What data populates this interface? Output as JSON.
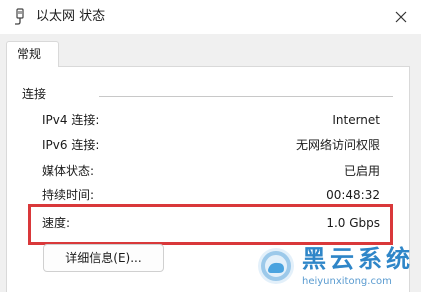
{
  "window": {
    "title": "以太网 状态",
    "title_icon": "ethernet-adapter-icon",
    "close_icon": "close-icon"
  },
  "tabs": [
    {
      "label": "常规",
      "selected": true
    }
  ],
  "connection": {
    "group_label": "连接",
    "rows": [
      {
        "label": "IPv4 连接:",
        "value": "Internet"
      },
      {
        "label": "IPv6 连接:",
        "value": "无网络访问权限"
      },
      {
        "label": "媒体状态:",
        "value": "已启用"
      },
      {
        "label": "持续时间:",
        "value": "00:48:32"
      },
      {
        "label": "速度:",
        "value": "1.0 Gbps"
      }
    ],
    "highlighted_row": "速度:"
  },
  "buttons": {
    "details_label": "详细信息(E)..."
  },
  "watermark": {
    "title": "黑云系统",
    "url": "heiyunxitong.com",
    "icon": "heiyun-logo-icon"
  },
  "colors": {
    "highlight": "#d9383a",
    "watermark": "#2f86c8"
  }
}
